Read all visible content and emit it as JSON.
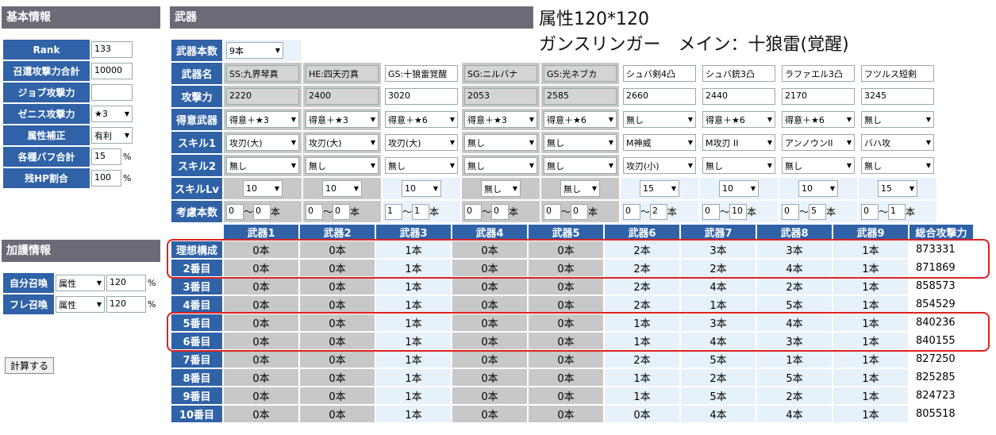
{
  "basic": {
    "title": "基本情報",
    "rows": [
      {
        "label": "Rank",
        "value": "133"
      },
      {
        "label": "召還攻撃力合計",
        "value": "10000"
      },
      {
        "label": "ジョブ攻撃力",
        "value": ""
      },
      {
        "label": "ゼニス攻撃力",
        "select": "★3"
      },
      {
        "label": "属性補正",
        "select": "有利"
      },
      {
        "label": "各種バフ合計",
        "value": "15",
        "unit": "%"
      },
      {
        "label": "残HP割合",
        "value": "100",
        "unit": "%"
      }
    ]
  },
  "blessing": {
    "title": "加護情報",
    "rows": [
      {
        "label": "自分召喚",
        "select": "属性",
        "value": "120",
        "unit": "%"
      },
      {
        "label": "フレ召喚",
        "select": "属性",
        "value": "120",
        "unit": "%"
      }
    ]
  },
  "calc_button": "計算する",
  "weapon": {
    "title": "武器",
    "count_label": "武器本数",
    "count_value": "9本",
    "labels": {
      "name": "武器名",
      "atk": "攻撃力",
      "specialty": "得意武器",
      "skill1": "スキル1",
      "skill2": "スキル2",
      "skill_lv": "スキルLv",
      "consider": "考慮本数"
    },
    "count_sep": "～",
    "count_unit": "本",
    "weapons": [
      {
        "name": "SS:九界琴真",
        "atk": "2220",
        "specialty": "得意＋★3",
        "skill1": "攻刃(大)",
        "skill2": "無し",
        "lv": "10",
        "min": "0",
        "max": "0",
        "gray": true
      },
      {
        "name": "HE:四天刃真",
        "atk": "2400",
        "specialty": "得意＋★3",
        "skill1": "攻刃(大)",
        "skill2": "無し",
        "lv": "10",
        "min": "0",
        "max": "0",
        "gray": true
      },
      {
        "name": "GS:十狼雷覚醒",
        "atk": "3020",
        "specialty": "得意＋★6",
        "skill1": "攻刃(大)",
        "skill2": "無し",
        "lv": "10",
        "min": "1",
        "max": "1",
        "gray": false
      },
      {
        "name": "SG:ニルバナ",
        "atk": "2053",
        "specialty": "得意＋★3",
        "skill1": "無し",
        "skill2": "無し",
        "lv": "無し",
        "min": "0",
        "max": "0",
        "gray": true
      },
      {
        "name": "GS:光ネブカ",
        "atk": "2585",
        "specialty": "得意＋★6",
        "skill1": "無し",
        "skill2": "無し",
        "lv": "無し",
        "min": "0",
        "max": "0",
        "gray": true
      },
      {
        "name": "シュバ剣4凸",
        "atk": "2660",
        "specialty": "無し",
        "skill1": "M神威",
        "skill2": "攻刃(小)",
        "lv": "15",
        "min": "0",
        "max": "2",
        "gray": false
      },
      {
        "name": "シュバ銃3凸",
        "atk": "2440",
        "specialty": "得意＋★6",
        "skill1": "M攻刃 II",
        "skill2": "無し",
        "lv": "10",
        "min": "0",
        "max": "10",
        "gray": false
      },
      {
        "name": "ラファエル3凸",
        "atk": "2170",
        "specialty": "得意＋★6",
        "skill1": "アンノウンII",
        "skill2": "無し",
        "lv": "10",
        "min": "0",
        "max": "5",
        "gray": false
      },
      {
        "name": "フツルス短剣",
        "atk": "3245",
        "specialty": "無し",
        "skill1": "バハ攻",
        "skill2": "無し",
        "lv": "15",
        "min": "0",
        "max": "1",
        "gray": false
      }
    ]
  },
  "results": {
    "headers": [
      "武器1",
      "武器2",
      "武器3",
      "武器4",
      "武器5",
      "武器6",
      "武器7",
      "武器8",
      "武器9",
      "総合攻撃力"
    ],
    "rows": [
      {
        "label": "理想構成",
        "cells": [
          "0本",
          "0本",
          "1本",
          "0本",
          "0本",
          "2本",
          "3本",
          "3本",
          "1本"
        ],
        "total": "873331"
      },
      {
        "label": "2番目",
        "cells": [
          "0本",
          "0本",
          "1本",
          "0本",
          "0本",
          "2本",
          "2本",
          "4本",
          "1本"
        ],
        "total": "871869"
      },
      {
        "label": "3番目",
        "cells": [
          "0本",
          "0本",
          "1本",
          "0本",
          "0本",
          "2本",
          "4本",
          "2本",
          "1本"
        ],
        "total": "858573"
      },
      {
        "label": "4番目",
        "cells": [
          "0本",
          "0本",
          "1本",
          "0本",
          "0本",
          "2本",
          "1本",
          "5本",
          "1本"
        ],
        "total": "854529"
      },
      {
        "label": "5番目",
        "cells": [
          "0本",
          "0本",
          "1本",
          "0本",
          "0本",
          "1本",
          "3本",
          "4本",
          "1本"
        ],
        "total": "840236"
      },
      {
        "label": "6番目",
        "cells": [
          "0本",
          "0本",
          "1本",
          "0本",
          "0本",
          "1本",
          "4本",
          "3本",
          "1本"
        ],
        "total": "840155"
      },
      {
        "label": "7番目",
        "cells": [
          "0本",
          "0本",
          "1本",
          "0本",
          "0本",
          "2本",
          "5本",
          "1本",
          "1本"
        ],
        "total": "827250"
      },
      {
        "label": "8番目",
        "cells": [
          "0本",
          "0本",
          "1本",
          "0本",
          "0本",
          "1本",
          "2本",
          "5本",
          "1本"
        ],
        "total": "825285"
      },
      {
        "label": "9番目",
        "cells": [
          "0本",
          "0本",
          "1本",
          "0本",
          "0本",
          "1本",
          "5本",
          "2本",
          "1本"
        ],
        "total": "824723"
      },
      {
        "label": "10番目",
        "cells": [
          "0本",
          "0本",
          "1本",
          "0本",
          "0本",
          "0本",
          "4本",
          "4本",
          "1本"
        ],
        "total": "805518"
      }
    ]
  },
  "annotation": {
    "line1": "属性120*120",
    "line2": "ガンスリンガー　メイン：十狼雷(覚醒)"
  },
  "colors": {
    "label_bg": "#2f62a7",
    "header_bg": "#6b6b78",
    "highlight": "#e02020",
    "gray": "#c8c8c8",
    "light": "#e6f1fa"
  }
}
